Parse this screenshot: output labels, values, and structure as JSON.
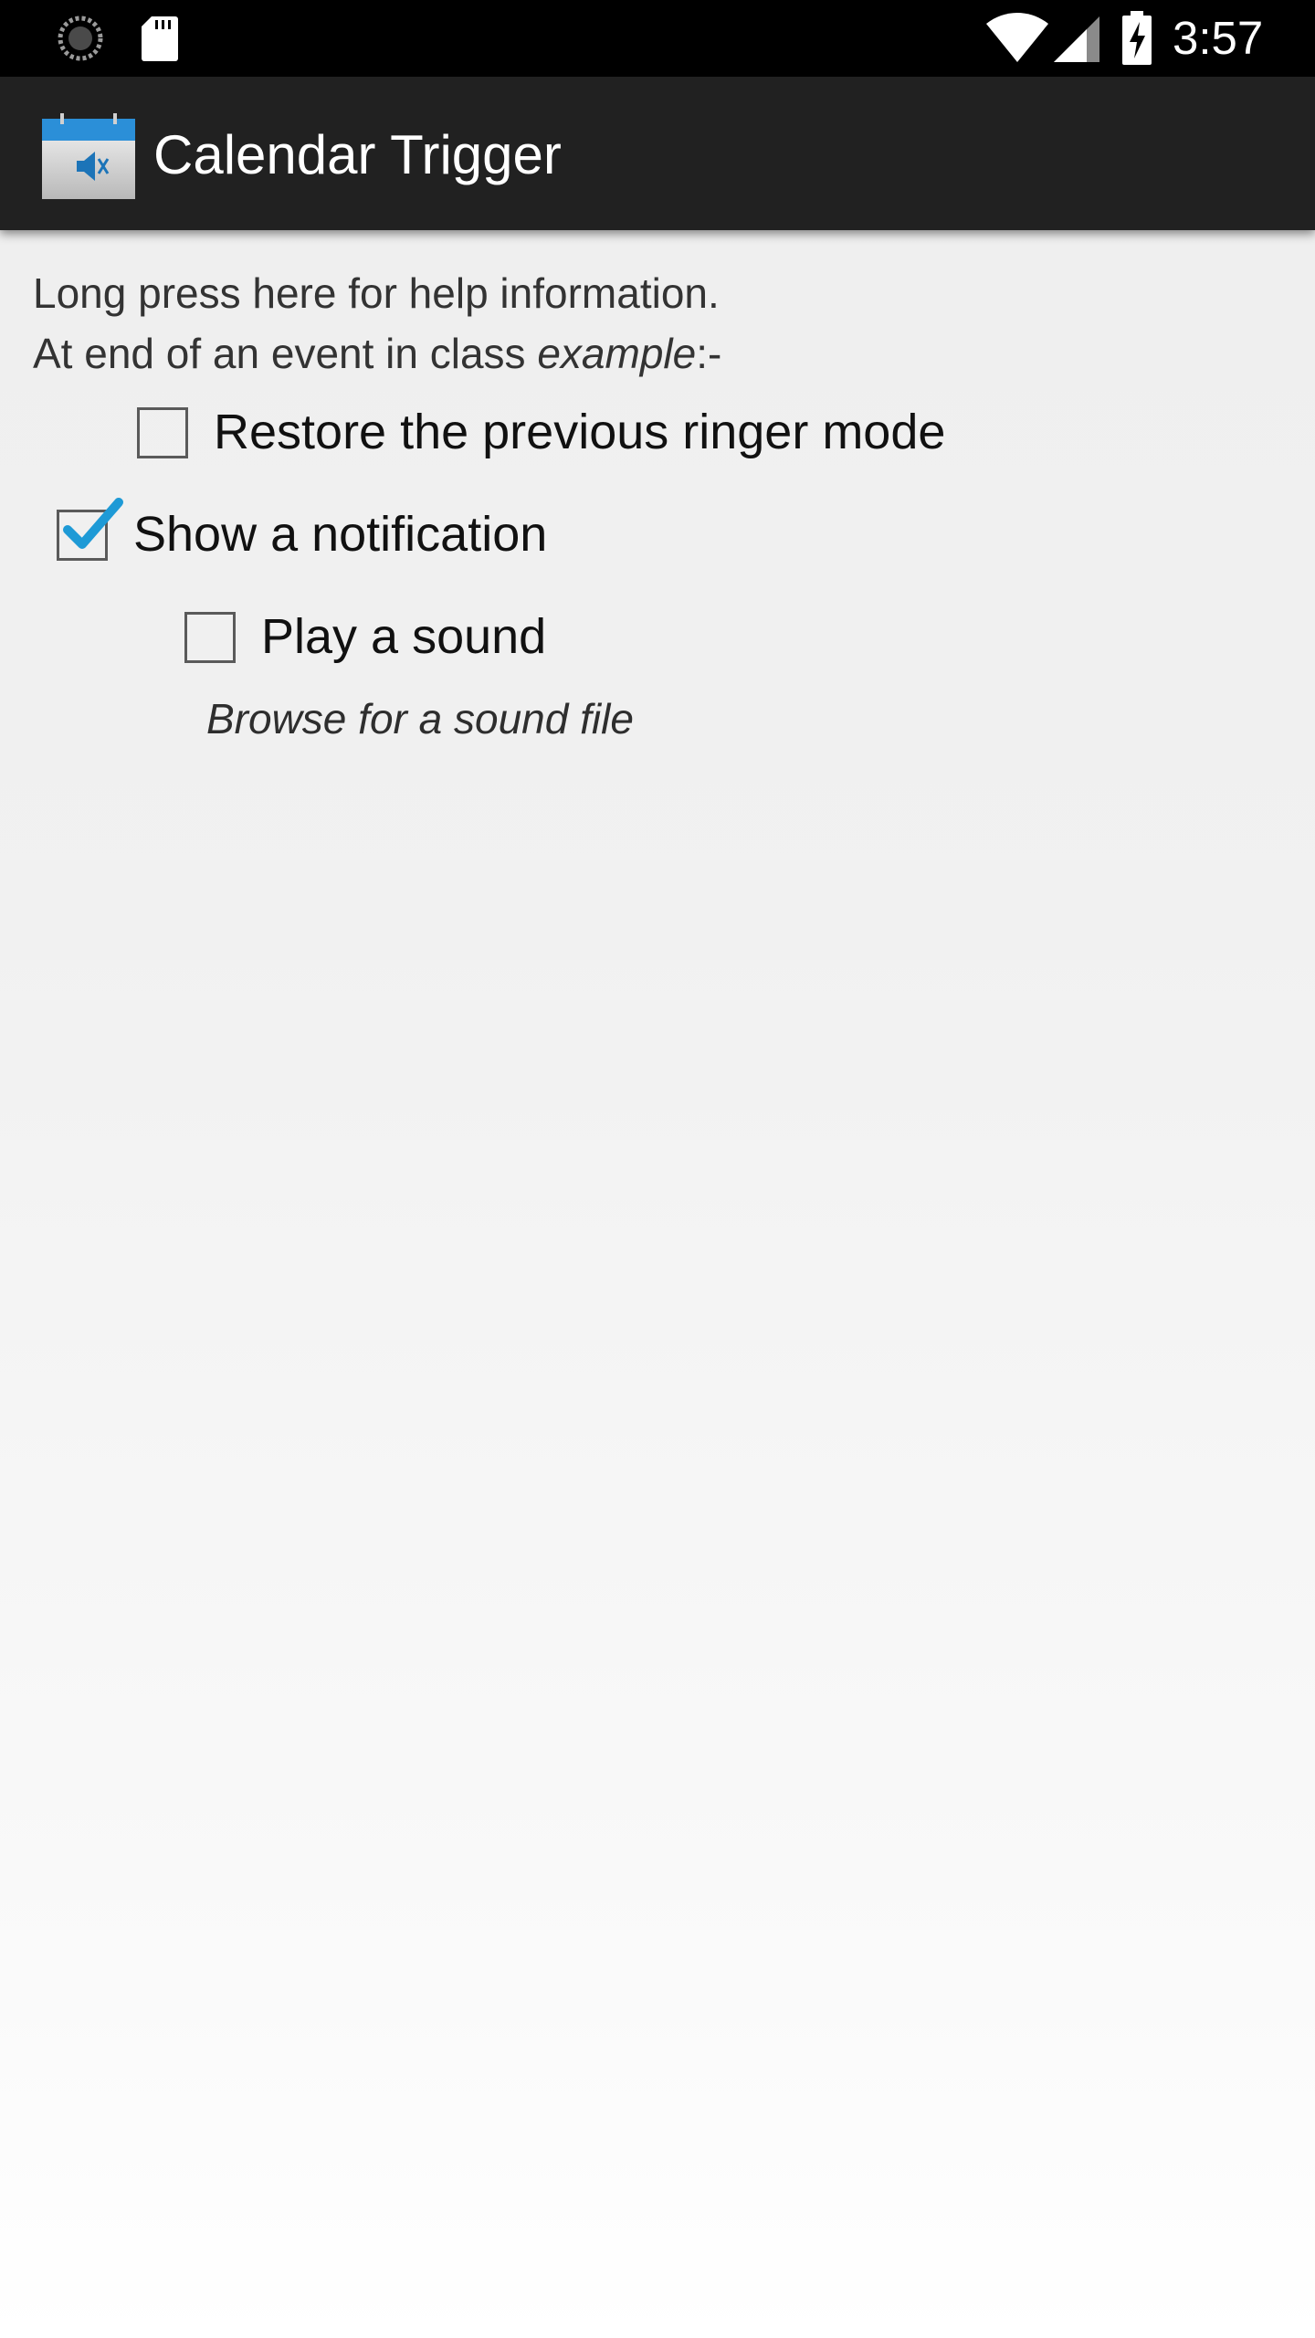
{
  "status_bar": {
    "time": "3:57",
    "icons": [
      "sync-icon",
      "sd-card-icon",
      "wifi-icon",
      "signal-icon",
      "battery-charging-icon"
    ]
  },
  "action_bar": {
    "app_icon": "calendar-mute-icon",
    "title": "Calendar Trigger"
  },
  "content": {
    "help_line_1": "Long press here for help information.",
    "help_line_2_prefix": "At end of an event in class ",
    "help_line_2_class": "example",
    "help_line_2_suffix": ":-",
    "options": [
      {
        "label": "Restore the previous ringer mode",
        "checked": false
      },
      {
        "label": "Show a notification",
        "checked": true
      },
      {
        "label": "Play a sound",
        "checked": false
      }
    ],
    "browse_label": "Browse for a sound file"
  },
  "colors": {
    "status_bar_bg": "#000000",
    "action_bar_bg": "#212121",
    "checkbox_accent": "#1e9ad6"
  }
}
